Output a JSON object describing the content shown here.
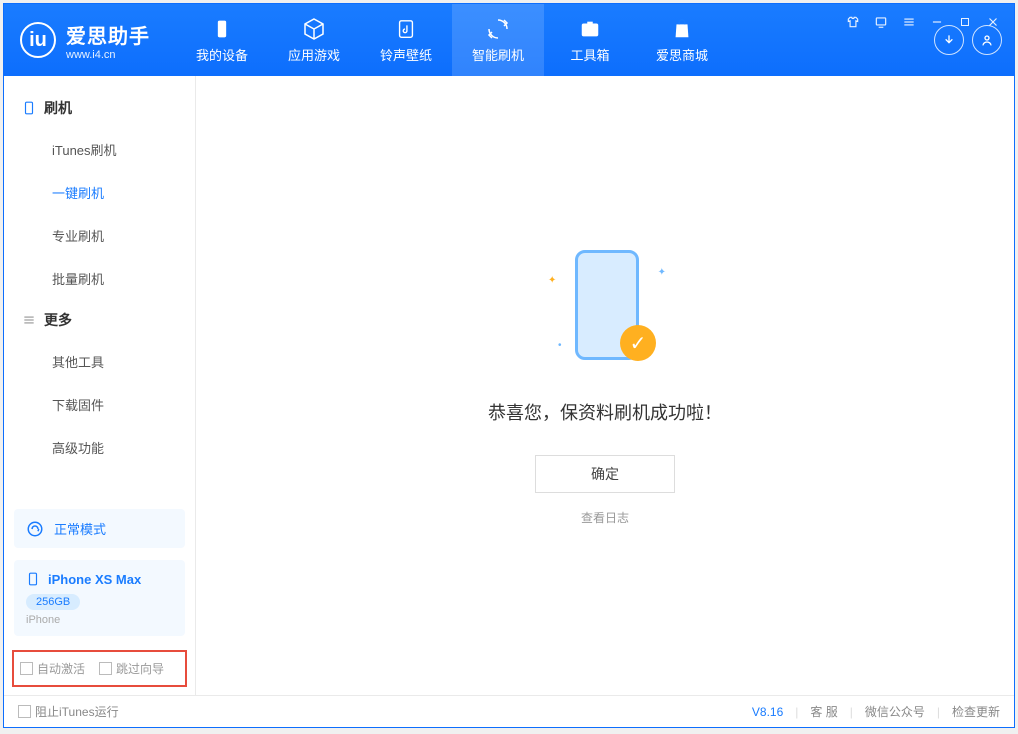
{
  "app": {
    "title": "爱思助手",
    "url": "www.i4.cn"
  },
  "nav": {
    "device": "我的设备",
    "apps": "应用游戏",
    "ringtone": "铃声壁纸",
    "flash": "智能刷机",
    "toolbox": "工具箱",
    "store": "爱思商城"
  },
  "sidebar": {
    "group_flash": "刷机",
    "items_flash": {
      "itunes": "iTunes刷机",
      "onekey": "一键刷机",
      "pro": "专业刷机",
      "batch": "批量刷机"
    },
    "group_more": "更多",
    "items_more": {
      "other": "其他工具",
      "firmware": "下载固件",
      "advanced": "高级功能"
    }
  },
  "status": {
    "mode": "正常模式"
  },
  "device": {
    "name": "iPhone XS Max",
    "storage": "256GB",
    "type": "iPhone"
  },
  "bottom_checks": {
    "auto_activate": "自动激活",
    "skip_guide": "跳过向导"
  },
  "main": {
    "success_msg": "恭喜您，保资料刷机成功啦！",
    "ok": "确定",
    "view_log": "查看日志"
  },
  "footer": {
    "block_itunes": "阻止iTunes运行",
    "version": "V8.16",
    "support": "客 服",
    "wechat": "微信公众号",
    "check_update": "检查更新"
  }
}
